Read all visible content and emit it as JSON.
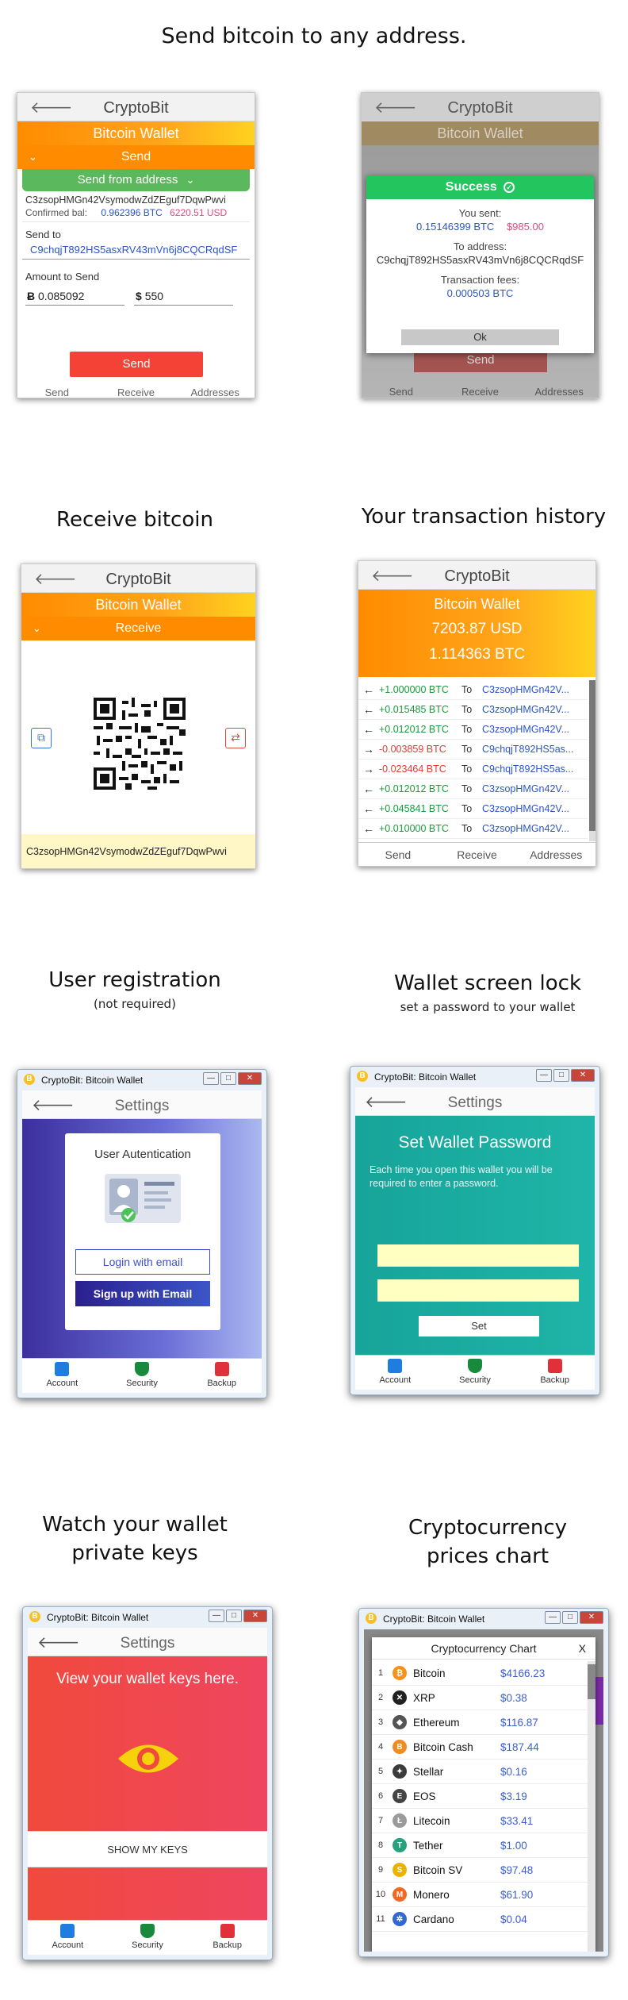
{
  "heading_main": "Send bitcoin to any address.",
  "app_title": "CryptoBit",
  "wallet_label": "Bitcoin Wallet",
  "send_panel": {
    "section": "Send",
    "send_from": "Send from address",
    "address": "C3zsopHMGn42VsymodwZdZEguf7DqwPwvi",
    "confirmed_label": "Confirmed bal:",
    "confirmed_btc": "0.962396 BTC",
    "confirmed_usd": "6220.51 USD",
    "send_to_label": "Send to",
    "send_to_value": "C9chqjT892HS5asxRV43mVn6j8CQCRqdSF",
    "amount_label": "Amount to Send",
    "amount_btc": "0.085092",
    "amount_usd": "550",
    "btc_symbol": "Ƀ",
    "usd_symbol": "$",
    "send_button": "Send",
    "tabs": [
      "Send",
      "Receive",
      "Addresses"
    ]
  },
  "success_dialog": {
    "title": "Success",
    "sent_label": "You sent:",
    "sent_btc": "0.15146399 BTC",
    "sent_usd": "$985.00",
    "to_label": "To address:",
    "to_value": "C9chqjT892HS5asxRV43mVn6j8CQCRqdSF",
    "fees_label": "Transaction fees:",
    "fees_value": "0.000503 BTC",
    "ok": "Ok",
    "bg_send": "Send",
    "bg_tabs": [
      "Send",
      "Receive",
      "Addresses"
    ]
  },
  "receive": {
    "heading": "Receive bitcoin",
    "section": "Receive",
    "address": "C3zsopHMGn42VsymodwZdZEguf7DqwPwvi"
  },
  "history": {
    "heading": "Your transaction history",
    "usd": "7203.87 USD",
    "btc": "1.114363 BTC",
    "to_label": "To",
    "rows": [
      {
        "dir": "←",
        "amount": "+1.000000 BTC",
        "addr": "C3zsopHMGn42V..."
      },
      {
        "dir": "←",
        "amount": "+0.015485 BTC",
        "addr": "C3zsopHMGn42V..."
      },
      {
        "dir": "←",
        "amount": "+0.012012 BTC",
        "addr": "C3zsopHMGn42V..."
      },
      {
        "dir": "→",
        "amount": "-0.003859 BTC",
        "addr": "C9chqjT892HS5as..."
      },
      {
        "dir": "→",
        "amount": "-0.023464 BTC",
        "addr": "C9chqjT892HS5as..."
      },
      {
        "dir": "←",
        "amount": "+0.012012 BTC",
        "addr": "C3zsopHMGn42V..."
      },
      {
        "dir": "←",
        "amount": "+0.045841 BTC",
        "addr": "C3zsopHMGn42V..."
      },
      {
        "dir": "←",
        "amount": "+0.010000 BTC",
        "addr": "C3zsopHMGn42V..."
      }
    ],
    "tabs": [
      "Send",
      "Receive",
      "Addresses"
    ]
  },
  "registration": {
    "heading": "User registration",
    "sub": "(not required)",
    "card_title": "User Autentication",
    "login": "Login with email",
    "signup": "Sign up with Email"
  },
  "lock": {
    "heading": "Wallet screen lock",
    "sub": "set a password  to your wallet",
    "title": "Set Wallet Password",
    "desc": "Each time you open this wallet you will be required to enter a password.",
    "set": "Set"
  },
  "keys": {
    "heading_line1": "Watch your wallet",
    "heading_line2": "private keys",
    "text": "View your wallet keys here.",
    "button": "SHOW MY KEYS"
  },
  "chart": {
    "heading_line1": "Cryptocurrency",
    "heading_line2": "prices chart",
    "title": "Cryptocurrency Chart",
    "close": "X",
    "rows": [
      {
        "n": "1",
        "name": "Bitcoin",
        "price": "$4166.23",
        "color": "#f7931a",
        "glyph": "₿"
      },
      {
        "n": "2",
        "name": "XRP",
        "price": "$0.38",
        "color": "#222222",
        "glyph": "✕"
      },
      {
        "n": "3",
        "name": "Ethereum",
        "price": "$116.87",
        "color": "#555555",
        "glyph": "◆"
      },
      {
        "n": "4",
        "name": "Bitcoin Cash",
        "price": "$187.44",
        "color": "#f28b20",
        "glyph": "B"
      },
      {
        "n": "5",
        "name": "Stellar",
        "price": "$0.16",
        "color": "#3b3b3b",
        "glyph": "✦"
      },
      {
        "n": "6",
        "name": "EOS",
        "price": "$3.19",
        "color": "#444444",
        "glyph": "E"
      },
      {
        "n": "7",
        "name": "Litecoin",
        "price": "$33.41",
        "color": "#9a9a9a",
        "glyph": "Ł"
      },
      {
        "n": "8",
        "name": "Tether",
        "price": "$1.00",
        "color": "#26a17b",
        "glyph": "T"
      },
      {
        "n": "9",
        "name": "Bitcoin SV",
        "price": "$97.48",
        "color": "#eab300",
        "glyph": "S"
      },
      {
        "n": "10",
        "name": "Monero",
        "price": "$61.90",
        "color": "#f26822",
        "glyph": "M"
      },
      {
        "n": "11",
        "name": "Cardano",
        "price": "$0.04",
        "color": "#3468d1",
        "glyph": "✲"
      }
    ]
  },
  "win_title": "CryptoBit: Bitcoin Wallet",
  "settings_title": "Settings",
  "bottom_nav": [
    "Account",
    "Security",
    "Backup"
  ],
  "colors": {
    "orange": "#ff8c00",
    "green": "#5cb85c",
    "red": "#f44336",
    "success": "#22c55e",
    "teal": "#12a69a",
    "purple": "#4a3aa8"
  }
}
